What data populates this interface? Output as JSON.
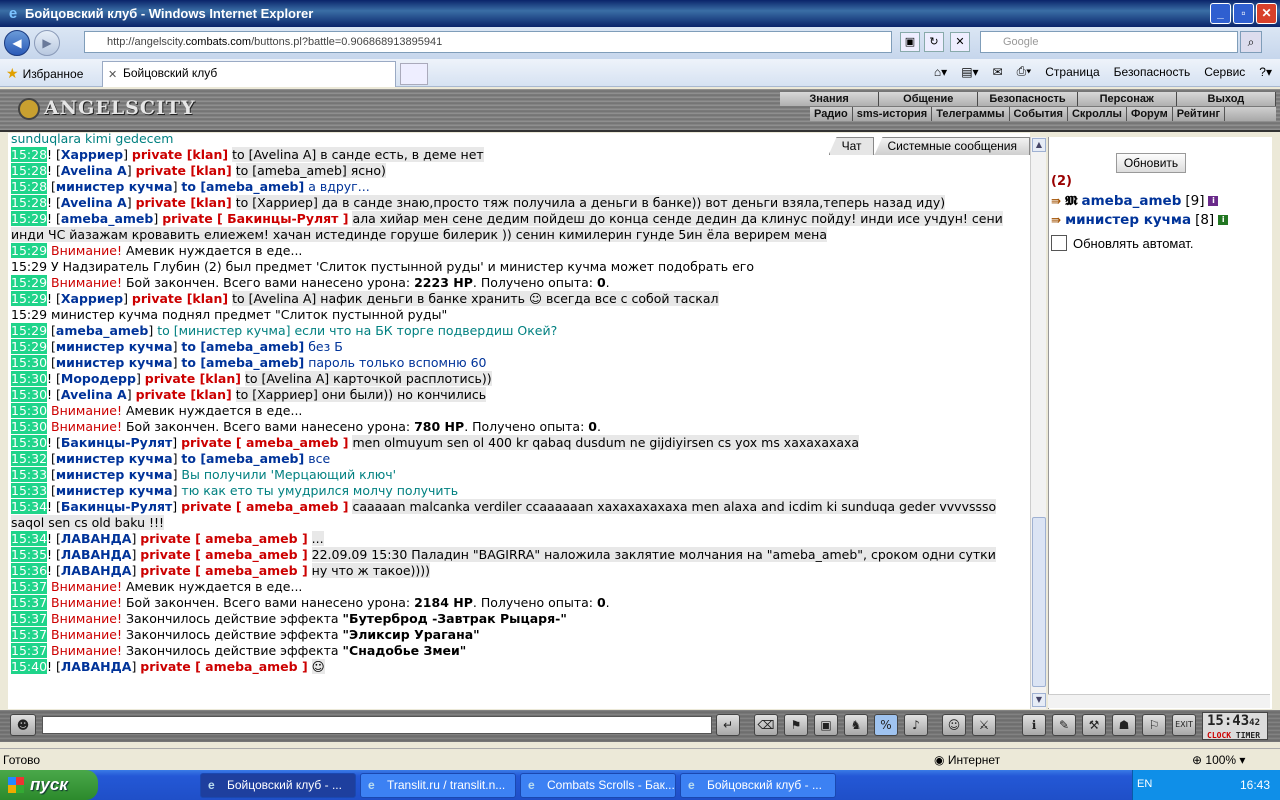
{
  "window": {
    "title": "Бойцовский клуб - Windows Internet Explorer"
  },
  "browser": {
    "url_prefix": "http://angelscity.",
    "url_domain": "combats.com",
    "url_path": "/buttons.pl?battle=0.906868913895941",
    "search_placeholder": "Google",
    "favorites_label": "Избранное",
    "tab_title": "Бойцовский клуб",
    "commands": {
      "page": "Страница",
      "security": "Безопасность",
      "service": "Сервис"
    }
  },
  "game": {
    "logo": "ANGELSCITY",
    "menu_top": [
      "Знания",
      "Общение",
      "Безопасность",
      "Персонаж",
      "Выход"
    ],
    "menu_sub": [
      "Радио",
      "sms-история",
      "Телеграммы",
      "События",
      "Скроллы",
      "Форум",
      "Рейтинг"
    ],
    "chat_tabs": [
      "Чат",
      "Системные сообщения"
    ],
    "chat_head": "sunduqlara kimi gedecem",
    "lines": [
      {
        "t": "15:28",
        "n": "Харриер",
        "p": "private [klan]",
        "m": "to [Avelina A] в санде есть, в деме нет"
      },
      {
        "t": "15:28",
        "n": "Avelina A",
        "p": "private [klan]",
        "m": "to [ameba_ameb] ясно)"
      },
      {
        "t": "15:28",
        "n": "министер кучма",
        "p": "to [ameba_ameb]",
        "m": "а вдруг..."
      },
      {
        "t": "15:28",
        "n": "Avelina A",
        "p": "private [klan]",
        "m": "to [Харриер] да в санде знаю,просто тяж получила а деньги в банке)) вот деньги взяла,теперь назад иду)"
      },
      {
        "t": "15:29",
        "n": "ameba_ameb",
        "p": "private [ Бакинцы-Рулят ]",
        "m": "ала хийар мен сене дедим пойдеш до конца сенде дедин да клинус пойду! инди исе учдун! сени инди ЧС йазажам кровавить елиежем! хачан истединде горуше билерик )) сенин кимилерин гунде 5ин ёла верирем мена"
      },
      {
        "t": "15:29",
        "sys": "Внимание!",
        "m": "Амевик нуждается в еде..."
      },
      {
        "t": "15:29",
        "m": "У Надзиратель Глубин (2) был предмет 'Слиток пустынной руды' и министер кучма может подобрать его"
      },
      {
        "t": "15:29",
        "sys": "Внимание!",
        "m": "Бой закончен. Всего вами нанесено урона:",
        "v1": "2223 HP",
        "m2": ". Получено опыта:",
        "v2": "0"
      },
      {
        "t": "15:29",
        "n": "Харриер",
        "p": "private [klan]",
        "m": "to [Avelina A] нафик деньги в банке хранить ☺ всегда все с собой таскал"
      },
      {
        "t": "15:29",
        "m": "министер кучма поднял предмет \"Слиток пустынной руды\""
      },
      {
        "t": "15:29",
        "n": "ameba_ameb",
        "m": "to [министер кучма] если что на БК торге подвердиш Окей?"
      },
      {
        "t": "15:29",
        "n": "министер кучма",
        "p": "to [ameba_ameb]",
        "m": "без Б"
      },
      {
        "t": "15:30",
        "n": "министер кучма",
        "p": "to [ameba_ameb]",
        "m": "пароль только вспомню 60"
      },
      {
        "t": "15:30",
        "n": "Мородерр",
        "p": "private [klan]",
        "m": "to [Avelina A] карточкой расплотись))"
      },
      {
        "t": "15:30",
        "n": "Avelina A",
        "p": "private [klan]",
        "m": "to [Харриер] они были)) но кончились"
      },
      {
        "t": "15:30",
        "sys": "Внимание!",
        "m": "Амевик нуждается в еде..."
      },
      {
        "t": "15:30",
        "sys": "Внимание!",
        "m": "Бой закончен. Всего вами нанесено урона:",
        "v1": "780 HP",
        "m2": ". Получено опыта:",
        "v2": "0"
      },
      {
        "t": "15:30",
        "n": "Бакинцы-Рулят",
        "p": "private [ ameba_ameb ]",
        "m": "men olmuyum sen ol 400 kr qabaq dusdum ne gijdiyirsen cs yox ms хахахахаха"
      },
      {
        "t": "15:32",
        "n": "министер кучма",
        "p": "to [ameba_ameb]",
        "m": "все"
      },
      {
        "t": "15:33",
        "n": "министер кучма",
        "m": "Вы получили 'Мерцающий ключ'"
      },
      {
        "t": "15:33",
        "n": "министер кучма",
        "m": "тю как ето ты умудрился молчу получить"
      },
      {
        "t": "15:34",
        "n": "Бакинцы-Рулят",
        "p": "private [ ameba_ameb ]",
        "m": "caaaaan malcanka verdiler ccaaaaaan хахахахахаха men alaxa and icdim ki sunduqa geder vvvvssso saqol sen cs old baku !!!"
      },
      {
        "t": "15:34",
        "n": "ЛАВАНДА",
        "p": "private [ ameba_ameb ]",
        "m": "..."
      },
      {
        "t": "15:35",
        "n": "ЛАВАНДА",
        "p": "private [ ameba_ameb ]",
        "m": "22.09.09 15:30 Паладин \"BAGIRRA\" наложила заклятие молчания на \"ameba_ameb\", сроком одни сутки"
      },
      {
        "t": "15:36",
        "n": "ЛАВАНДА",
        "p": "private [ ameba_ameb ]",
        "m": "ну что ж такое))))"
      },
      {
        "t": "15:37",
        "sys": "Внимание!",
        "m": "Амевик нуждается в еде..."
      },
      {
        "t": "15:37",
        "sys": "Внимание!",
        "m": "Бой закончен. Всего вами нанесено урона:",
        "v1": "2184 HP",
        "m2": ". Получено опыта:",
        "v2": "0"
      },
      {
        "t": "15:37",
        "sys": "Внимание!",
        "m": "Закончилось действие эффекта",
        "v1": "\"Бутерброд -Завтрак Рыцаря-\""
      },
      {
        "t": "15:37",
        "sys": "Внимание!",
        "m": "Закончилось действие эффекта",
        "v1": "\"Эликсир Урагана\""
      },
      {
        "t": "15:37",
        "sys": "Внимание!",
        "m": "Закончилось действие эффекта",
        "v1": "\"Снадобье Змеи\""
      },
      {
        "t": "15:40",
        "n": "ЛАВАНДА",
        "p": "private [ ameba_ameb ]",
        "m": "☺"
      }
    ],
    "side": {
      "refresh": "Обновить",
      "count": "(2)",
      "users": [
        {
          "name": "ameba_ameb",
          "level": "[9]"
        },
        {
          "name": "министер кучма",
          "level": "[8]"
        }
      ],
      "auto": "Обновлять автомат."
    },
    "clock": {
      "time": "15:43",
      "sec": "42",
      "label1": "CLOCK",
      "label2": "TIMER"
    }
  },
  "status": {
    "left": "Готово",
    "zone": "Интернет",
    "zoom": "100%"
  },
  "taskbar": {
    "start": "пуск",
    "tasks": [
      "Бойцовский клуб - ...",
      "Translit.ru / translit.n...",
      "Combats Scrolls - Бак...",
      "Бойцовский клуб - ..."
    ],
    "lang": "EN",
    "time": "16:43"
  }
}
